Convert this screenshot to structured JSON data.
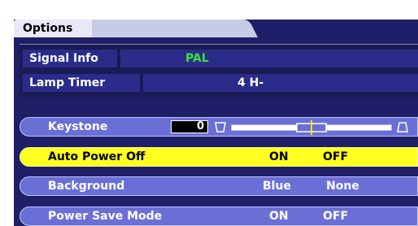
{
  "menu": {
    "tab_label": "Options"
  },
  "info": {
    "signal_label": "Signal Info",
    "signal_value": "PAL",
    "lamp_label": "Lamp Timer",
    "lamp_value": "4 H-"
  },
  "items": [
    {
      "label": "Keystone",
      "value": "0",
      "slider_level": 0.5
    },
    {
      "label": "Auto Power Off",
      "option1": "ON",
      "option2": "OFF",
      "selected": true
    },
    {
      "label": "Background",
      "option1": "Blue",
      "option2": "None"
    },
    {
      "label": "Power Save Mode",
      "option1": "ON",
      "option2": "OFF"
    }
  ],
  "colors": {
    "panel": "#1e1f66",
    "item": "#6a6fd6",
    "highlight": "#ffff22",
    "signal_value": "#3ce03c"
  }
}
